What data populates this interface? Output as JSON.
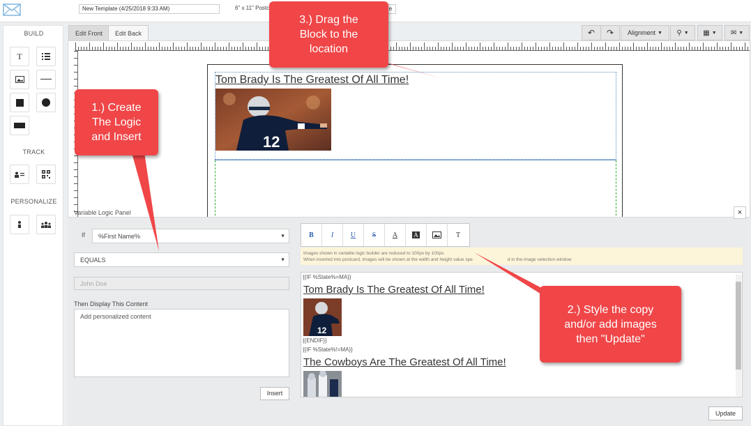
{
  "topbar": {
    "template_name": "New Template (4/25/2018 9:33 AM)",
    "size_label": "6\" x 11\" Postc",
    "edge_button": "e"
  },
  "sidebar": {
    "build_heading": "BUILD",
    "track_heading": "TRACK",
    "personalize_heading": "PERSONALIZE",
    "text_tool": "T"
  },
  "tabs": {
    "front": "Edit Front",
    "back": "Edit Back"
  },
  "toolbar": {
    "alignment": "Alignment"
  },
  "canvas": {
    "block_title": "Tom Brady Is The Greatest Of All Time!"
  },
  "panel": {
    "title": "Variable Logic Panel",
    "close": "×",
    "if_label": "If",
    "if_field": "%First Name%",
    "operator": "EQUALS",
    "value_placeholder": "John Doe",
    "then_label": "Then Display This Content",
    "content_placeholder": "Add personalized content",
    "insert": "Insert",
    "update": "Update",
    "format_buttons": [
      "B",
      "I",
      "U",
      "S",
      "A",
      "A",
      "",
      "T"
    ],
    "notice_line1": "Images shown in variable logic builder are reduced to 100px by 100px.",
    "notice_line2": "When inserted into postcard, images will be shown at the width and height value spe",
    "notice_line2b": "d in the image selection window"
  },
  "preview": {
    "if_ma": "{{IF %State%=MA}}",
    "title_ma": "Tom Brady Is The Greatest Of All Time!",
    "endif": "{{ENDIF}}",
    "if_not_ma": "{{IF %State%!=MA}}",
    "title_not_ma": "The Cowboys Are The Greatest Of All Time!"
  },
  "callouts": {
    "step1": [
      "1.) Create",
      "The Logic",
      "and Insert"
    ],
    "step2": [
      "2.) Style the copy",
      "and/or add images",
      "then \"Update\""
    ],
    "step3": [
      "3.) Drag the",
      "Block to the",
      "location"
    ]
  },
  "colors": {
    "callout": "#f04648",
    "link_blue": "#2a5db0",
    "panel_bg": "#e9ebed"
  }
}
